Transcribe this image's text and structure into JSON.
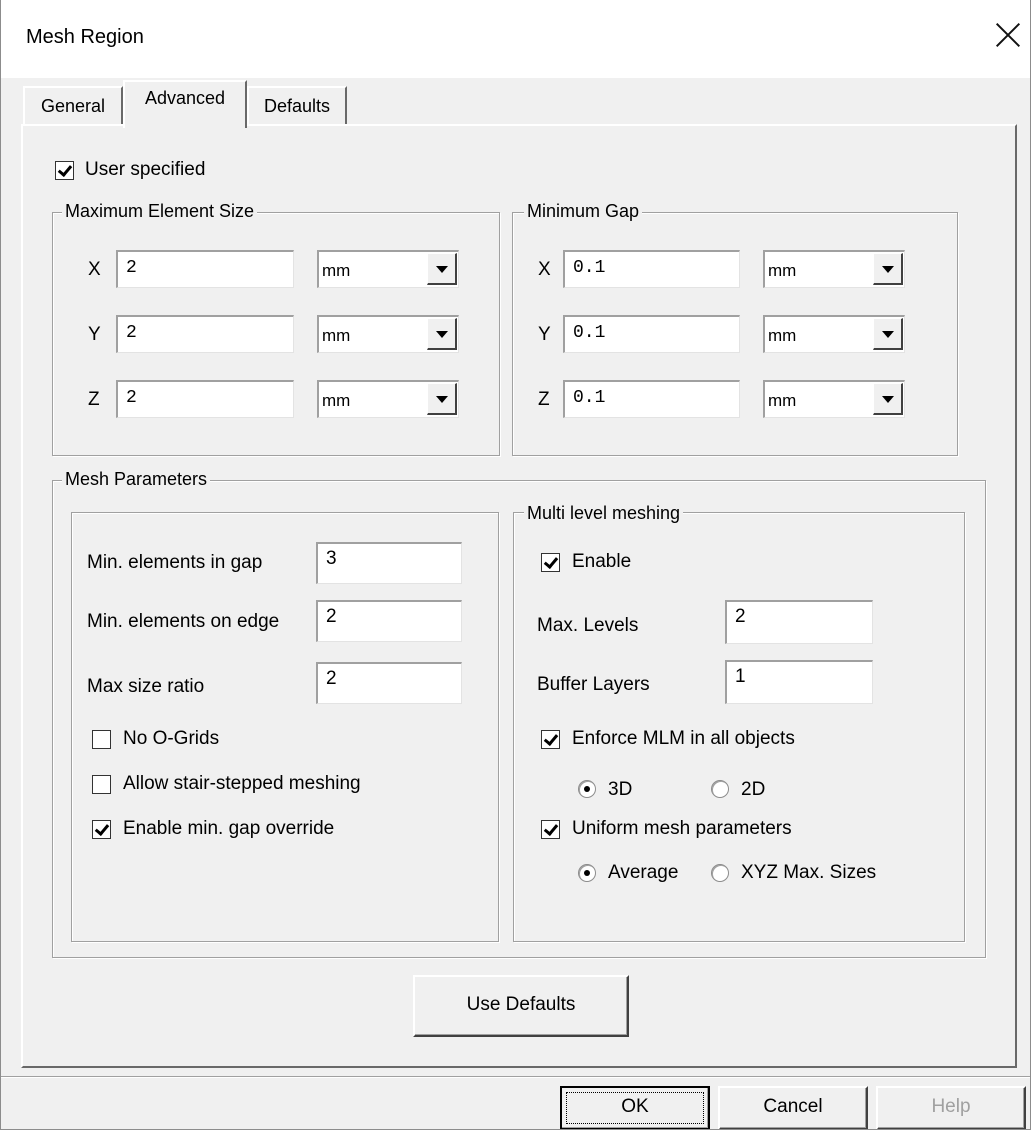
{
  "window": {
    "title": "Mesh Region"
  },
  "tabs": [
    {
      "label": "General"
    },
    {
      "label": "Advanced"
    },
    {
      "label": "Defaults"
    }
  ],
  "user_specified": {
    "label": "User specified",
    "checked": true
  },
  "max_element_size": {
    "legend": "Maximum Element Size",
    "rows": [
      {
        "axis": "X",
        "value": "2",
        "unit": "mm"
      },
      {
        "axis": "Y",
        "value": "2",
        "unit": "mm"
      },
      {
        "axis": "Z",
        "value": "2",
        "unit": "mm"
      }
    ]
  },
  "min_gap": {
    "legend": "Minimum Gap",
    "rows": [
      {
        "axis": "X",
        "value": "0.1",
        "unit": "mm"
      },
      {
        "axis": "Y",
        "value": "0.1",
        "unit": "mm"
      },
      {
        "axis": "Z",
        "value": "0.1",
        "unit": "mm"
      }
    ]
  },
  "mesh_parameters": {
    "legend": "Mesh Parameters",
    "min_elements_in_gap": {
      "label": "Min. elements in gap",
      "value": "3"
    },
    "min_elements_on_edge": {
      "label": "Min. elements on edge",
      "value": "2"
    },
    "max_size_ratio": {
      "label": "Max size ratio",
      "value": "2"
    },
    "no_ogrids": {
      "label": "No O-Grids",
      "checked": false
    },
    "stair_stepped": {
      "label": "Allow stair-stepped meshing",
      "checked": false
    },
    "min_gap_override": {
      "label": "Enable min. gap override",
      "checked": true
    }
  },
  "multi_level": {
    "legend": "Multi level meshing",
    "enable": {
      "label": "Enable",
      "checked": true
    },
    "max_levels": {
      "label": "Max. Levels",
      "value": "2"
    },
    "buffer_layers": {
      "label": "Buffer Layers",
      "value": "1"
    },
    "enforce_mlm": {
      "label": "Enforce MLM in all objects",
      "checked": true
    },
    "dim_3d": {
      "label": "3D",
      "selected": true
    },
    "dim_2d": {
      "label": "2D",
      "selected": false
    },
    "uniform_mesh": {
      "label": "Uniform mesh parameters",
      "checked": true
    },
    "average": {
      "label": "Average",
      "selected": true
    },
    "xyz_max": {
      "label": "XYZ Max. Sizes",
      "selected": false
    }
  },
  "buttons": {
    "use_defaults": "Use Defaults",
    "ok": "OK",
    "cancel": "Cancel",
    "help": "Help"
  }
}
